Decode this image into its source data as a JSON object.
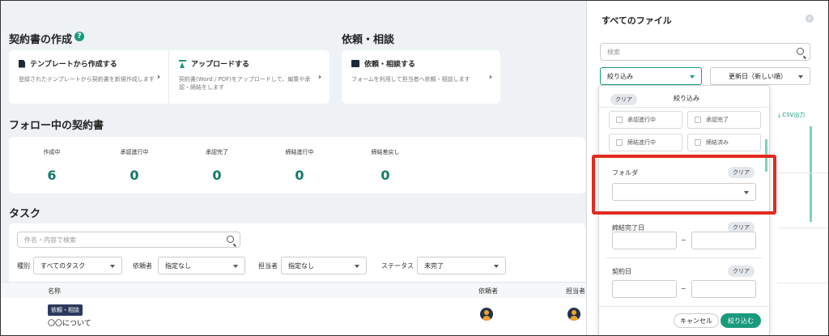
{
  "main": {
    "contract_create_title": "契約書の作成",
    "help_glyph": "?",
    "request_title": "依頼・相談",
    "cards": {
      "template": {
        "title": "テンプレートから作成する",
        "desc": "登録されたテンプレートから契約書を新規作成します"
      },
      "upload": {
        "title": "アップロードする",
        "desc": "契約書(Word / PDF)をアップロードして、編集や承認・締結をします"
      },
      "request": {
        "title": "依頼・相談する",
        "desc": "フォームを利用して担当者へ依頼・相談します"
      }
    },
    "chevron": "›",
    "followed_title": "フォロー中の契約書",
    "stats": [
      {
        "label": "作成中",
        "value": "6"
      },
      {
        "label": "承認進行中",
        "value": "0"
      },
      {
        "label": "承認完了",
        "value": "0"
      },
      {
        "label": "締結進行中",
        "value": "0"
      },
      {
        "label": "締結差戻し",
        "value": "0"
      }
    ],
    "task_title": "タスク",
    "task_search_placeholder": "件名・内容で検索",
    "filters": {
      "type_label": "種別",
      "type_value": "すべてのタスク",
      "requester_label": "依頼者",
      "requester_value": "指定なし",
      "assignee_label": "担当者",
      "assignee_value": "指定なし",
      "status_label": "ステータス",
      "status_value": "未完了"
    },
    "table": {
      "col_name": "名称",
      "col_requester": "依頼者",
      "col_assignee": "担当者",
      "row_badge": "依頼・相談",
      "row_title": "〇〇について"
    }
  },
  "panel": {
    "title": "すべてのファイル",
    "close_glyph": "×",
    "search_placeholder": "検索",
    "filter_button": "絞り込み",
    "sort_value": "更新日（新しい順）",
    "csv_label": "CSV出力",
    "dropdown": {
      "clear": "クリア",
      "header": "絞り込み",
      "checks": [
        "承認進行中",
        "承認完了",
        "締結進行中",
        "締結済み"
      ],
      "folder_label": "フォルダ",
      "completion_label": "締結完了日",
      "contract_date_label": "契約日",
      "range_sep": "~",
      "cancel": "キャンセル",
      "apply": "絞り込む"
    }
  },
  "colors": {
    "accent": "#1a9a7c",
    "highlight": "#e22b1f",
    "navy": "#2b3a5c"
  }
}
